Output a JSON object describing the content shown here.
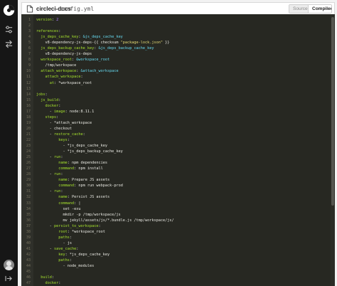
{
  "header": {
    "repo": "circleci-docs",
    "filename": "config.yml",
    "tabs": [
      {
        "label": "Source",
        "active": false
      },
      {
        "label": "Compiled",
        "active": true
      }
    ]
  },
  "rail": {
    "icons": [
      "circleci-logo-icon",
      "settings-sliders-icon",
      "swap-arrows-icon",
      "avatar",
      "expand-arrow-icon"
    ]
  },
  "editor": {
    "lines": [
      {
        "n": "1",
        "code": "<span class='k'>version</span>: <span class='n'>2</span>"
      },
      {
        "n": "2",
        "code": ""
      },
      {
        "n": "3",
        "code": "<span class='k'>references</span>:"
      },
      {
        "n": "4",
        "code": "  <span class='k'>js_deps_cache_key</span>: <span class='a'>&amp;js_deps_cache_key</span>"
      },
      {
        "n": "5",
        "code": "    v8-dependency-js-deps-{{ checksum <span class='s'>\"package-lock.json\"</span> }}"
      },
      {
        "n": "6",
        "code": "  <span class='k'>js_deps_backup_cache_key</span>: <span class='a'>&amp;js_deps_backup_cache_key</span>"
      },
      {
        "n": "7",
        "code": "    v8-dependency-js-deps"
      },
      {
        "n": "8",
        "code": "  <span class='k'>workspace_root</span>: <span class='a'>&amp;workspace_root</span>"
      },
      {
        "n": "9",
        "code": "    /tmp/workspace"
      },
      {
        "n": "10",
        "code": "  <span class='k'>attach_workspace</span>: <span class='a'>&amp;attach_workspace</span>"
      },
      {
        "n": "11",
        "code": "    <span class='k'>attach_workspace</span>:"
      },
      {
        "n": "12",
        "code": "      <span class='k'>at</span>: *workspace_root"
      },
      {
        "n": "13",
        "code": ""
      },
      {
        "n": "14",
        "code": "<span class='k'>jobs</span>:"
      },
      {
        "n": "15",
        "code": "  <span class='k'>js_build</span>:"
      },
      {
        "n": "16",
        "code": "    <span class='k'>docker</span>:"
      },
      {
        "n": "17",
        "code": "      - <span class='k'>image</span>: node:8.11.1"
      },
      {
        "n": "18",
        "code": "    <span class='k'>steps</span>:"
      },
      {
        "n": "19",
        "code": "      - *attach_workspace"
      },
      {
        "n": "20",
        "code": "      - checkout"
      },
      {
        "n": "21",
        "code": "      - <span class='k'>restore_cache</span>:"
      },
      {
        "n": "22",
        "code": "          <span class='k'>keys</span>:"
      },
      {
        "n": "23",
        "code": "            - *js_deps_cache_key"
      },
      {
        "n": "24",
        "code": "            - *js_deps_backup_cache_key"
      },
      {
        "n": "25",
        "code": "      - <span class='k'>run</span>:"
      },
      {
        "n": "26",
        "code": "          <span class='k'>name</span>: npm dependencies"
      },
      {
        "n": "27",
        "code": "          <span class='k'>command</span>: npm install"
      },
      {
        "n": "28",
        "code": "      - <span class='k'>run</span>:"
      },
      {
        "n": "29",
        "code": "          <span class='k'>name</span>: Prepare JS assets"
      },
      {
        "n": "30",
        "code": "          <span class='k'>command</span>: npm run webpack-prod"
      },
      {
        "n": "31",
        "code": "      - <span class='k'>run</span>:"
      },
      {
        "n": "32",
        "code": "          <span class='k'>name</span>: Persist JS assets"
      },
      {
        "n": "33",
        "code": "          <span class='k'>command</span>: |"
      },
      {
        "n": "34",
        "code": "            set -exu"
      },
      {
        "n": "35",
        "code": "            mkdir -p /tmp/workspace/js"
      },
      {
        "n": "36",
        "code": "            mv jekyll/assets/js/*.bundle.js /tmp/workspace/js/"
      },
      {
        "n": "37",
        "code": "      - <span class='k'>persist_to_workspace</span>:"
      },
      {
        "n": "38",
        "code": "          <span class='k'>root</span>: *workspace_root"
      },
      {
        "n": "39",
        "code": "          <span class='k'>paths</span>:"
      },
      {
        "n": "40",
        "code": "            - js"
      },
      {
        "n": "41",
        "code": "      - <span class='k'>save_cache</span>:"
      },
      {
        "n": "42",
        "code": "          <span class='k'>key</span>: *js_deps_cache_key"
      },
      {
        "n": "43",
        "code": "          <span class='k'>paths</span>:"
      },
      {
        "n": "44",
        "code": "            - node_modules"
      },
      {
        "n": "45",
        "code": ""
      },
      {
        "n": "46",
        "code": "  <span class='k'>build</span>:"
      },
      {
        "n": "47",
        "code": "    <span class='k'>docker</span>:"
      }
    ]
  }
}
